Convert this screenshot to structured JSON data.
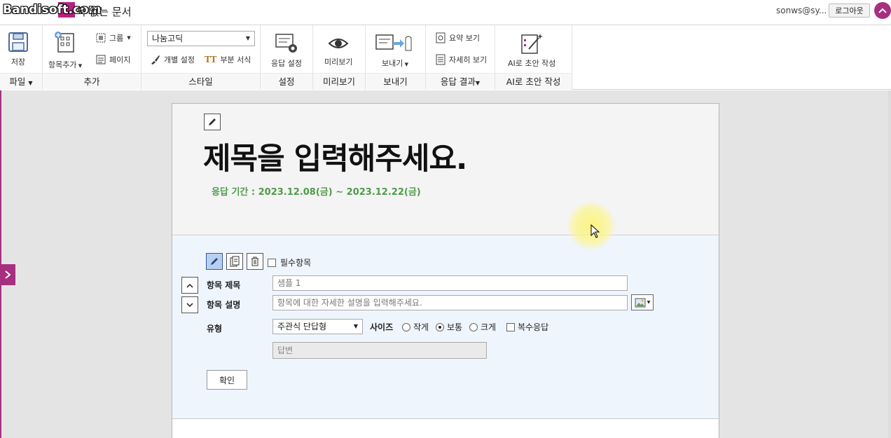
{
  "titlebar": {
    "watermark": "Bandisoft.com",
    "document_title": "목 없는 문서",
    "user": "sonws@sy...",
    "logout": "로그아웃"
  },
  "ribbon": {
    "file": {
      "save_label": "저장",
      "group_label": "파일"
    },
    "add": {
      "add_item_label": "항목추가",
      "group_btn": "그룹",
      "page_btn": "페이지",
      "group_label": "추가"
    },
    "style": {
      "font_value": "나눔고딕",
      "individual_setting": "개별 설정",
      "partial_format": "부분 서식",
      "group_label": "스타일"
    },
    "settings": {
      "response_settings": "응답 설정",
      "group_label": "설정"
    },
    "preview": {
      "preview_label": "미리보기",
      "group_label": "미리보기"
    },
    "export": {
      "export_label": "보내기",
      "group_label": "보내기"
    },
    "results": {
      "summary_view": "요약 보기",
      "detail_view": "자세히 보기",
      "group_label": "응답 결과"
    },
    "ai": {
      "ai_draft": "AI로 초안 작성",
      "group_label": "AI로 초안 작성"
    }
  },
  "form": {
    "title_placeholder": "제목을 입력해주세요.",
    "period": "응답 기간 : 2023.12.08(금) ~ 2023.12.22(금)"
  },
  "question": {
    "required_label": "필수항목",
    "title_label": "항목 제목",
    "title_value": "샘플 1",
    "desc_label": "항목 설명",
    "desc_placeholder": "항목에 대한 자세한 설명을 입력해주세요.",
    "type_label": "유형",
    "type_value": "주관식 단답형",
    "size_label": "사이즈",
    "size_small": "작게",
    "size_normal": "보통",
    "size_large": "크게",
    "multi_answer": "복수응답",
    "answer_placeholder": "답변",
    "confirm": "확인"
  },
  "colors": {
    "accent": "#a6307f",
    "period_green": "#4f9b49",
    "panel_bg": "#eff5fd"
  }
}
